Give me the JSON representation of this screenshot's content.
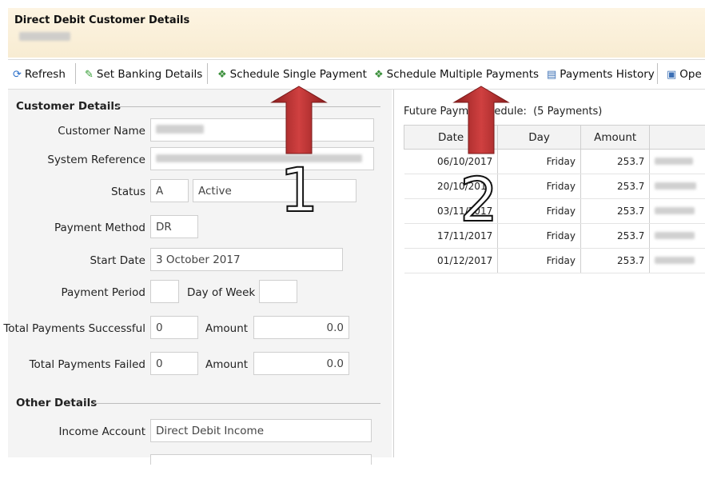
{
  "header": {
    "title": "Direct Debit Customer Details"
  },
  "toolbar": {
    "refresh": "Refresh",
    "set_banking": "Set Banking Details",
    "schedule_single": "Schedule Single Payment",
    "schedule_multiple": "Schedule Multiple Payments",
    "payments_history": "Payments History",
    "open": "Ope"
  },
  "customer_details": {
    "title": "Customer Details",
    "customer_name_label": "Customer Name",
    "system_reference_label": "System Reference",
    "status_label": "Status",
    "status_code": "A",
    "status_text": "Active",
    "payment_method_label": "Payment Method",
    "payment_method": "DR",
    "start_date_label": "Start Date",
    "start_date": "3 October 2017",
    "payment_period_label": "Payment Period",
    "payment_period": "",
    "day_of_week_label": "Day of Week",
    "day_of_week": "",
    "total_successful_label": "Total Payments Successful",
    "total_successful": "0",
    "amount_label": "Amount",
    "successful_amount": "0.0",
    "total_failed_label": "Total Payments Failed",
    "total_failed": "0",
    "failed_amount": "0.0"
  },
  "other_details": {
    "title": "Other Details",
    "income_account_label": "Income Account",
    "income_account": "Direct Debit Income"
  },
  "schedule": {
    "caption_a": "Future Payme",
    "caption_b": "hedule:",
    "count": "(5 Payments)",
    "columns": [
      "Date",
      "Day",
      "Amount"
    ],
    "rows": [
      {
        "date": "06/10/2017",
        "day": "Friday",
        "amount": "253.7"
      },
      {
        "date": "20/10/2017",
        "day": "Friday",
        "amount": "253.7"
      },
      {
        "date": "03/11/2017",
        "day": "Friday",
        "amount": "253.7"
      },
      {
        "date": "17/11/2017",
        "day": "Friday",
        "amount": "253.7"
      },
      {
        "date": "01/12/2017",
        "day": "Friday",
        "amount": "253.7"
      }
    ]
  },
  "annotations": {
    "one": "1",
    "two": "2"
  },
  "colors": {
    "arrow": "#b52a2a",
    "header_bg": "#fbf0da",
    "accent_green": "#3a9a3a"
  }
}
